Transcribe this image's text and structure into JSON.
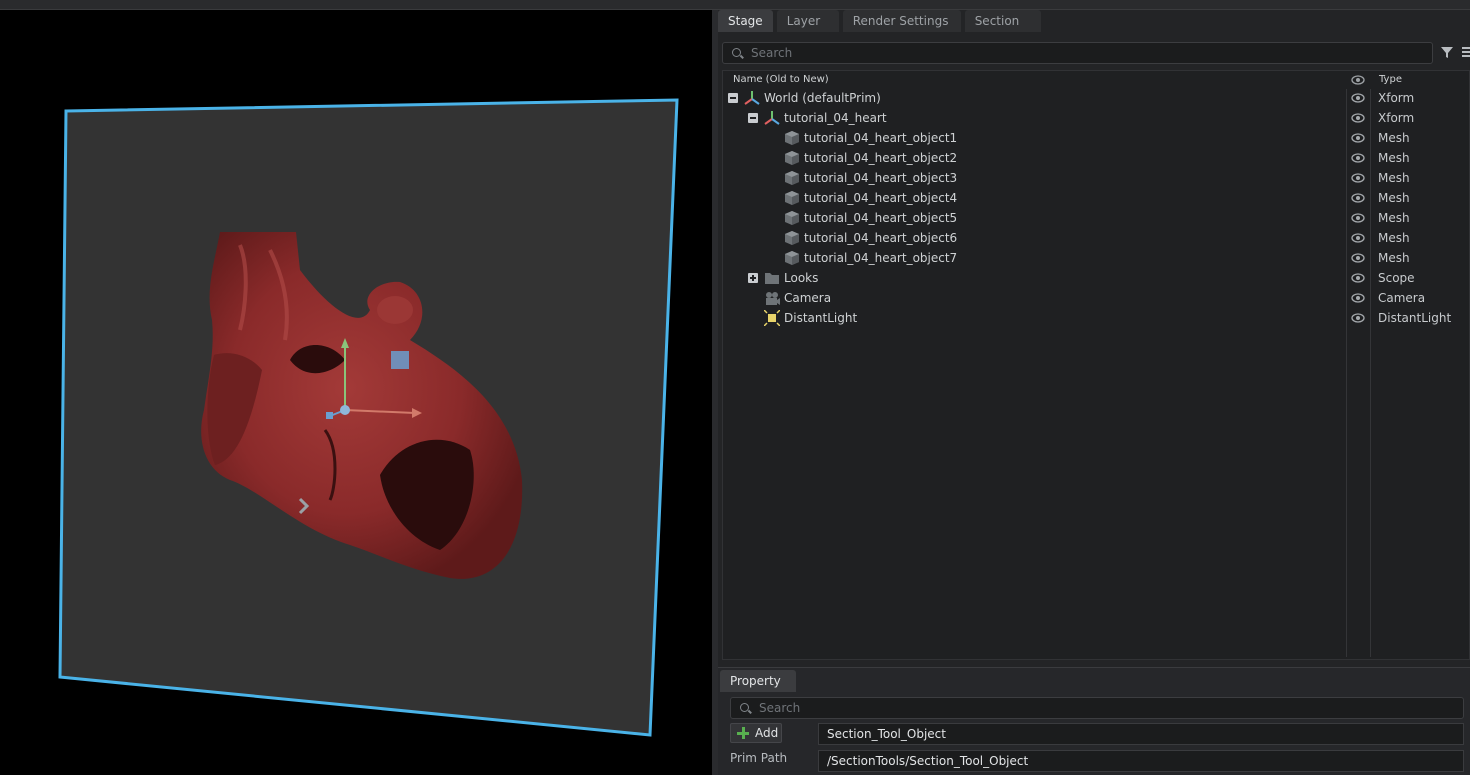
{
  "tabs": [
    {
      "label": "Stage"
    },
    {
      "label": "Layer"
    },
    {
      "label": "Render Settings"
    },
    {
      "label": "Section"
    }
  ],
  "stage": {
    "search_placeholder": "Search",
    "col_name": "Name (Old to New)",
    "col_type": "Type",
    "rows": [
      {
        "label": "World (defaultPrim)",
        "type": "Xform",
        "icon": "xform-axes-icon",
        "expander": "collapse"
      },
      {
        "label": "tutorial_04_heart",
        "type": "Xform",
        "icon": "xform-axes-icon",
        "expander": "collapse"
      },
      {
        "label": "tutorial_04_heart_object1",
        "type": "Mesh",
        "icon": "mesh-cube-icon"
      },
      {
        "label": "tutorial_04_heart_object2",
        "type": "Mesh",
        "icon": "mesh-cube-icon"
      },
      {
        "label": "tutorial_04_heart_object3",
        "type": "Mesh",
        "icon": "mesh-cube-icon"
      },
      {
        "label": "tutorial_04_heart_object4",
        "type": "Mesh",
        "icon": "mesh-cube-icon"
      },
      {
        "label": "tutorial_04_heart_object5",
        "type": "Mesh",
        "icon": "mesh-cube-icon"
      },
      {
        "label": "tutorial_04_heart_object6",
        "type": "Mesh",
        "icon": "mesh-cube-icon"
      },
      {
        "label": "tutorial_04_heart_object7",
        "type": "Mesh",
        "icon": "mesh-cube-icon"
      },
      {
        "label": "Looks",
        "type": "Scope",
        "icon": "folder-icon",
        "expander": "expand"
      },
      {
        "label": "Camera",
        "type": "Camera",
        "icon": "camera-icon"
      },
      {
        "label": "DistantLight",
        "type": "DistantLight",
        "icon": "light-icon"
      }
    ]
  },
  "property": {
    "tab_label": "Property",
    "search_placeholder": "Search",
    "add_label": "Add",
    "name_value": "Section_Tool_Object",
    "prim_path_label": "Prim Path",
    "prim_path_value": "/SectionTools/Section_Tool_Object"
  },
  "colors": {
    "section_plane_outline": "#4ab3e8",
    "heart": "#8a2a2a",
    "plane_fill": "#333333"
  }
}
